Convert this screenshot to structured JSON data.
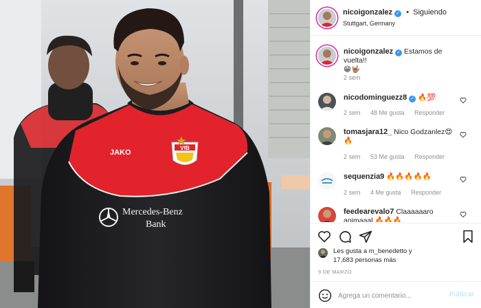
{
  "post": {
    "username": "nicoigonzalez",
    "follow_status": "Siguiendo",
    "location": "Stuttgart, Germany",
    "photo": {
      "jersey_brand": "JAKO",
      "sponsor_line1": "Mercedes-Benz",
      "sponsor_line2": "Bank",
      "crest_text": "VfB"
    }
  },
  "comments": [
    {
      "username": "nicoigonzalez",
      "verified": true,
      "text": "Estamos de vuelta!!",
      "emoji": "😁🤟🏽",
      "time": "2 sem",
      "likes": "",
      "reply": ""
    },
    {
      "username": "nicodominguezz8",
      "verified": true,
      "text": "",
      "emoji": "🔥💯",
      "time": "2 sem",
      "likes": "48 Me gusta",
      "reply": "Responder"
    },
    {
      "username": "tomasjara12_",
      "verified": false,
      "text": "Nico Godzanlez😍",
      "emoji": "🔥",
      "time": "2 sem",
      "likes": "53 Me gusta",
      "reply": "Responder"
    },
    {
      "username": "sequenzia9",
      "verified": false,
      "text": "",
      "emoji": "🔥🔥🔥🔥🔥",
      "time": "2 sem",
      "likes": "4 Me gusta",
      "reply": "Responder"
    },
    {
      "username": "feedearevalo7",
      "verified": false,
      "text": "Claaaaaaro animaaal",
      "emoji": "🔥🔥🔥",
      "time": "",
      "likes": "",
      "reply": ""
    }
  ],
  "likes": {
    "line1": "Les gusta a m_benedetto y",
    "line2": "17,683 personas más"
  },
  "date": "9 DE MARZO",
  "add_comment": {
    "placeholder": "Agrega un comentario...",
    "publish_label": "Publicar"
  },
  "colors": {
    "accent": "#3897f0",
    "publish_disabled": "#b2dffc",
    "jersey_red": "#e2232b",
    "jersey_black": "#1c1c1e"
  },
  "icons": [
    "heart-icon",
    "comment-icon",
    "share-icon",
    "bookmark-icon",
    "emoji-icon",
    "verified-icon"
  ]
}
